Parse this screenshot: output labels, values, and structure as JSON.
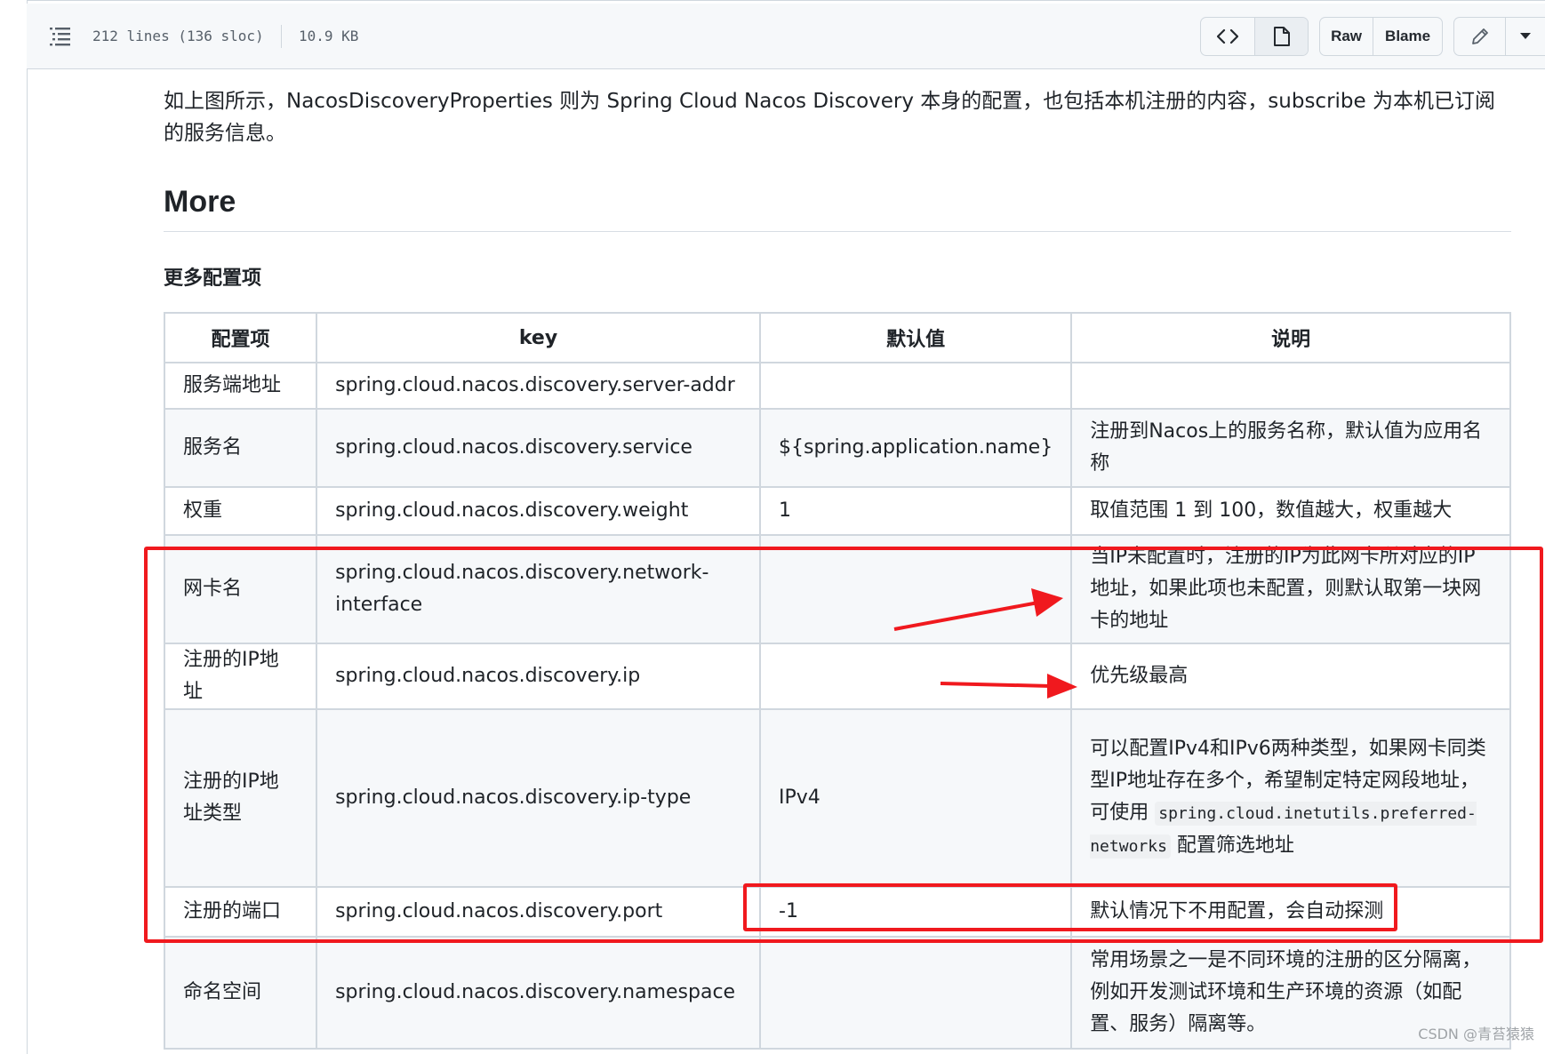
{
  "file_header": {
    "lines": "212 lines (136 sloc)",
    "size": "10.9 KB",
    "raw_label": "Raw",
    "blame_label": "Blame"
  },
  "content": {
    "intro": "如上图所示，NacosDiscoveryProperties 则为 Spring Cloud Nacos Discovery 本身的配置，也包括本机注册的内容，subscribe 为本机已订阅的服务信息。",
    "heading": "More",
    "subheading": "更多配置项"
  },
  "table": {
    "headers": [
      "配置项",
      "key",
      "默认值",
      "说明"
    ],
    "rows": [
      {
        "item": "服务端地址",
        "key": "spring.cloud.nacos.discovery.server-addr",
        "default": "",
        "desc": ""
      },
      {
        "item": "服务名",
        "key": "spring.cloud.nacos.discovery.service",
        "default": "${spring.application.name}",
        "desc": "注册到Nacos上的服务名称，默认值为应用名称"
      },
      {
        "item": "权重",
        "key": "spring.cloud.nacos.discovery.weight",
        "default": "1",
        "desc": "取值范围 1 到 100，数值越大，权重越大"
      },
      {
        "item": "网卡名",
        "key": "spring.cloud.nacos.discovery.network-interface",
        "default": "",
        "desc": "当IP未配置时，注册的IP为此网卡所对应的IP地址，如果此项也未配置，则默认取第一块网卡的地址"
      },
      {
        "item": "注册的IP地址",
        "key": "spring.cloud.nacos.discovery.ip",
        "default": "",
        "desc": "优先级最高"
      },
      {
        "item": "注册的IP地址类型",
        "key": "spring.cloud.nacos.discovery.ip-type",
        "default": "IPv4",
        "desc_pre": "可以配置IPv4和IPv6两种类型，如果网卡同类型IP地址存在多个，希望制定特定网段地址，可使用",
        "desc_code": "spring.cloud.inetutils.preferred-networks",
        "desc_post": "配置筛选地址"
      },
      {
        "item": "注册的端口",
        "key": "spring.cloud.nacos.discovery.port",
        "default": "-1",
        "desc": "默认情况下不用配置，会自动探测"
      },
      {
        "item": "命名空间",
        "key": "spring.cloud.nacos.discovery.namespace",
        "default": "",
        "desc": "常用场景之一是不同环境的注册的区分隔离，例如开发测试环境和生产环境的资源（如配置、服务）隔离等。"
      }
    ]
  },
  "annotation_color": "#f0191e",
  "watermark": "CSDN @青苔猿猿"
}
